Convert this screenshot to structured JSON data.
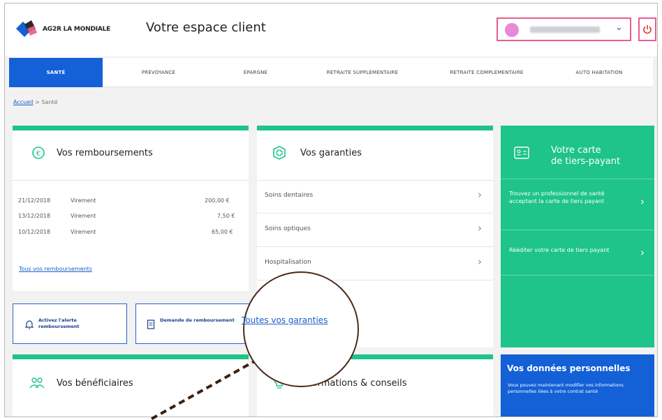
{
  "header": {
    "logo_text": "AG2R LA MONDIALE",
    "title": "Votre espace client",
    "user_icon": "avatar",
    "power_icon": "power-icon"
  },
  "nav": {
    "items": [
      {
        "label": "SANTÉ",
        "active": true
      },
      {
        "label": "PRÉVOYANCE",
        "active": false
      },
      {
        "label": "ÉPARGNE",
        "active": false
      },
      {
        "label": "RETRAITE SUPPLÉMENTAIRE",
        "active": false
      },
      {
        "label": "RETRAITE COMPLÉMENTAIRE",
        "active": false
      },
      {
        "label": "AUTO HABITATION",
        "active": false
      }
    ]
  },
  "breadcrumb": {
    "home": "Accueil",
    "separator": ">",
    "current": "Santé"
  },
  "remboursements": {
    "title": "Vos remboursements",
    "rows": [
      {
        "date": "21/12/2018",
        "type": "Virement",
        "amount": "200,00 €"
      },
      {
        "date": "13/12/2018",
        "type": "Virement",
        "amount": "7,50 €"
      },
      {
        "date": "10/12/2018",
        "type": "Virement",
        "amount": "65,00 €"
      }
    ],
    "link": "Tous vos remboursements"
  },
  "actions": {
    "alert": "Activez l'alerte remboursement",
    "demande": "Demande de remboursement"
  },
  "garanties": {
    "title": "Vos garanties",
    "rows": [
      "Soins dentaires",
      "Soins optiques",
      "Hospitalisation"
    ],
    "link": "Toutes vos garanties"
  },
  "beneficiaires": {
    "title": "Vos bénéficiaires"
  },
  "informations": {
    "title": "Informations & conseils"
  },
  "tiers_payant": {
    "title_line1": "Votre carte",
    "title_line2": "de tiers-payant",
    "item1": "Trouvez un professionnel de santé acceptant la carte de tiers payant",
    "item2": "Rééditer votre carte de tiers payant"
  },
  "donnees": {
    "title": "Vos données personnelles",
    "text": "Vous pouvez maintenant modifier vos informations personnelles liées à votre contrat santé"
  },
  "colors": {
    "green": "#1ec489",
    "blue": "#1360d7",
    "accent_pink": "#e85d8f"
  }
}
